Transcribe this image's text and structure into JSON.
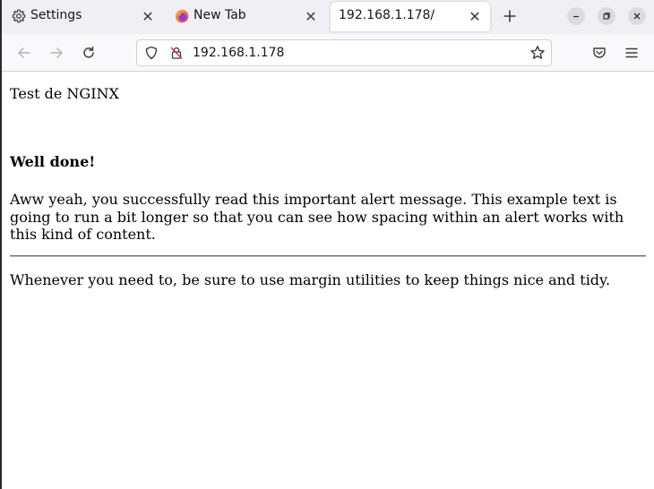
{
  "tabs": [
    {
      "label": "Settings",
      "icon": "gear-icon",
      "active": false
    },
    {
      "label": "New Tab",
      "icon": "firefox-icon",
      "active": false
    },
    {
      "label": "192.168.1.178/",
      "icon": "",
      "active": true
    }
  ],
  "toolbar": {
    "url": "192.168.1.178"
  },
  "page": {
    "title": "Test de NGINX",
    "heading": "Well done!",
    "body": "Aww yeah, you successfully read this important alert message. This example text is going to run a bit longer so that you can see how spacing within an alert works with this kind of content.",
    "footer": "Whenever you need to, be sure to use margin utilities to keep things nice and tidy."
  },
  "colors": {
    "tabstrip_bg": "#f0f0f4",
    "navbar_bg": "#f9f9fb",
    "firefox_orange": "#ff7139",
    "firefox_purple": "#9059ff"
  }
}
